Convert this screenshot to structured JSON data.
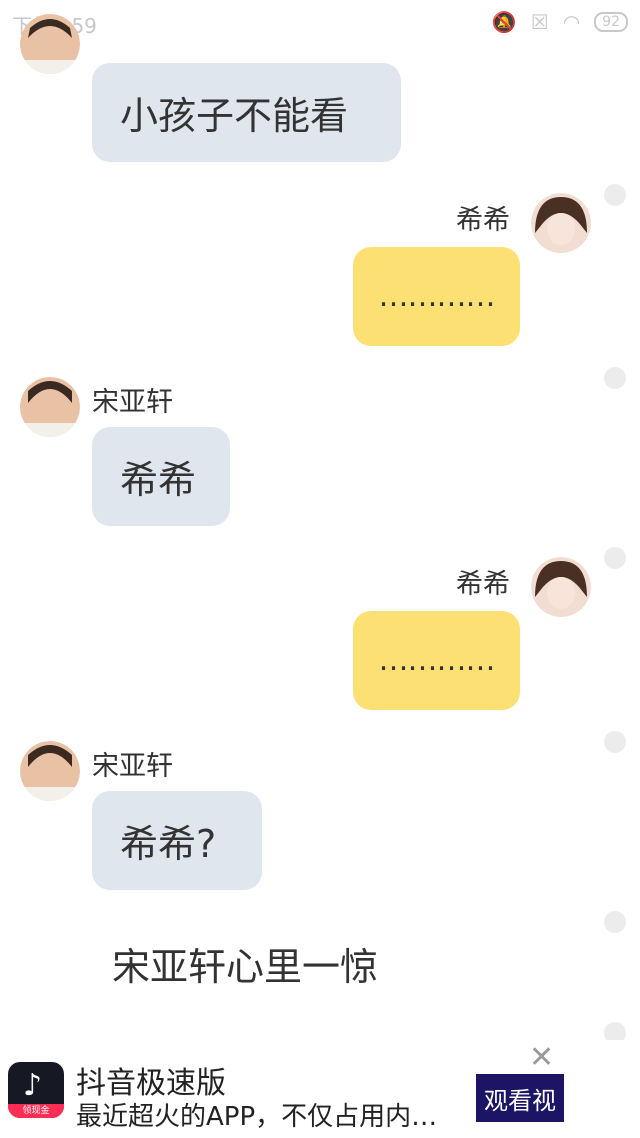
{
  "status_bar": {
    "time": "下午2:59",
    "battery": "92"
  },
  "characters": {
    "left": {
      "name": "宋亚轩"
    },
    "right": {
      "name": "希希"
    }
  },
  "messages": [
    {
      "side": "left",
      "text": "小孩子不能看"
    },
    {
      "side": "right",
      "name": "希希",
      "text": "…………"
    },
    {
      "side": "left",
      "name": "宋亚轩",
      "text": "希希"
    },
    {
      "side": "right",
      "name": "希希",
      "text": "…………"
    },
    {
      "side": "left",
      "name": "宋亚轩",
      "text": "希希?"
    }
  ],
  "narration": "宋亚轩心里一惊",
  "ad": {
    "title": "抖音极速版",
    "description": "最近超火的APP，不仅占用内…",
    "cta": "观看视",
    "icon_tag": "领现金"
  },
  "colors": {
    "left_bubble": "#dfe6ed",
    "right_bubble": "#fde073",
    "ad_cta": "#1c1464"
  }
}
